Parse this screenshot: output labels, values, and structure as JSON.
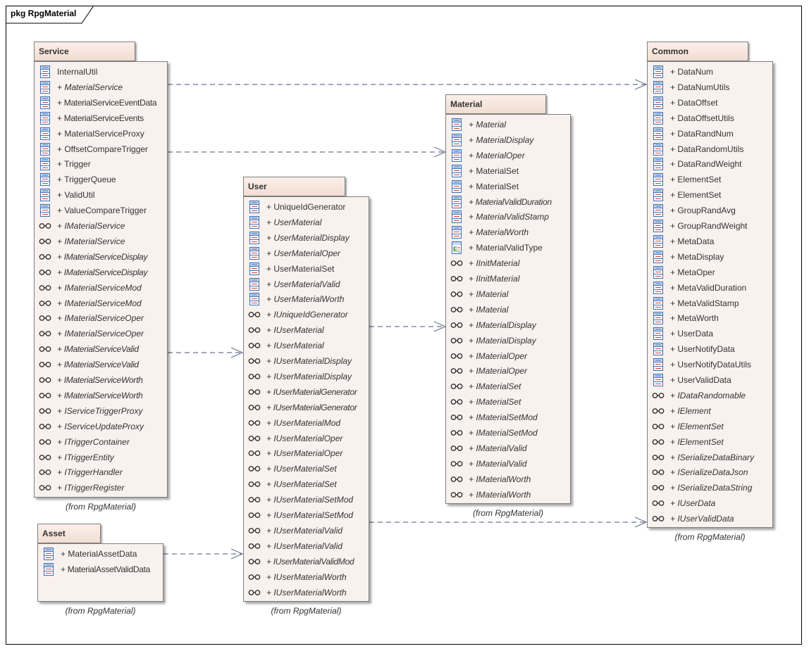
{
  "diagram": {
    "title": "pkg RpgMaterial"
  },
  "packages": [
    {
      "id": "service",
      "name": "Service",
      "from": "(from RpgMaterial)",
      "items": [
        {
          "label": "InternalUtil",
          "kind": "class",
          "italic": false
        },
        {
          "label": "+ MaterialService",
          "kind": "class",
          "italic": true
        },
        {
          "label": "+ MaterialServiceEventData",
          "kind": "class",
          "italic": false
        },
        {
          "label": "+ MaterialServiceEvents",
          "kind": "class",
          "italic": false
        },
        {
          "label": "+ MaterialServiceProxy",
          "kind": "class",
          "italic": false
        },
        {
          "label": "+ OffsetCompareTrigger",
          "kind": "class",
          "italic": false
        },
        {
          "label": "+ Trigger",
          "kind": "class",
          "italic": false
        },
        {
          "label": "+ TriggerQueue",
          "kind": "class",
          "italic": false
        },
        {
          "label": "+ ValidUtil",
          "kind": "class",
          "italic": false
        },
        {
          "label": "+ ValueCompareTrigger",
          "kind": "class",
          "italic": false
        },
        {
          "label": "+ IMaterialService",
          "kind": "interface",
          "italic": true
        },
        {
          "label": "+ IMaterialService",
          "kind": "interface",
          "italic": true
        },
        {
          "label": "+ IMaterialServiceDisplay",
          "kind": "interface",
          "italic": true
        },
        {
          "label": "+ IMaterialServiceDisplay",
          "kind": "interface",
          "italic": true
        },
        {
          "label": "+ IMaterialServiceMod",
          "kind": "interface",
          "italic": true
        },
        {
          "label": "+ IMaterialServiceMod",
          "kind": "interface",
          "italic": true
        },
        {
          "label": "+ IMaterialServiceOper",
          "kind": "interface",
          "italic": true
        },
        {
          "label": "+ IMaterialServiceOper",
          "kind": "interface",
          "italic": true
        },
        {
          "label": "+ IMaterialServiceValid",
          "kind": "interface",
          "italic": true
        },
        {
          "label": "+ IMaterialServiceValid",
          "kind": "interface",
          "italic": true
        },
        {
          "label": "+ IMaterialServiceWorth",
          "kind": "interface",
          "italic": true
        },
        {
          "label": "+ IMaterialServiceWorth",
          "kind": "interface",
          "italic": true
        },
        {
          "label": "+ IServiceTriggerProxy",
          "kind": "interface",
          "italic": true
        },
        {
          "label": "+ IServiceUpdateProxy",
          "kind": "interface",
          "italic": true
        },
        {
          "label": "+ ITriggerContainer",
          "kind": "interface",
          "italic": true
        },
        {
          "label": "+ ITriggerEntity",
          "kind": "interface",
          "italic": true
        },
        {
          "label": "+ ITriggerHandler",
          "kind": "interface",
          "italic": true
        },
        {
          "label": "+ ITriggerRegister",
          "kind": "interface",
          "italic": true
        }
      ]
    },
    {
      "id": "asset",
      "name": "Asset",
      "from": "(from RpgMaterial)",
      "items": [
        {
          "label": "+ MaterialAssetData",
          "kind": "class",
          "italic": false
        },
        {
          "label": "+ MaterialAssetValidData",
          "kind": "class",
          "italic": false
        }
      ]
    },
    {
      "id": "user",
      "name": "User",
      "from": "(from RpgMaterial)",
      "items": [
        {
          "label": "+ UniqueIdGenerator",
          "kind": "class",
          "italic": false
        },
        {
          "label": "+ UserMaterial",
          "kind": "class",
          "italic": true
        },
        {
          "label": "+ UserMaterialDisplay",
          "kind": "class",
          "italic": true
        },
        {
          "label": "+ UserMaterialOper",
          "kind": "class",
          "italic": true
        },
        {
          "label": "+ UserMaterialSet",
          "kind": "class",
          "italic": false
        },
        {
          "label": "+ UserMaterialValid",
          "kind": "class",
          "italic": true
        },
        {
          "label": "+ UserMaterialWorth",
          "kind": "class",
          "italic": true
        },
        {
          "label": "+ IUniqueIdGenerator",
          "kind": "interface",
          "italic": true
        },
        {
          "label": "+ IUserMaterial",
          "kind": "interface",
          "italic": true
        },
        {
          "label": "+ IUserMaterial",
          "kind": "interface",
          "italic": true
        },
        {
          "label": "+ IUserMaterialDisplay",
          "kind": "interface",
          "italic": true
        },
        {
          "label": "+ IUserMaterialDisplay",
          "kind": "interface",
          "italic": true
        },
        {
          "label": "+ IUserMaterialGenerator",
          "kind": "interface",
          "italic": true
        },
        {
          "label": "+ IUserMaterialGenerator",
          "kind": "interface",
          "italic": true
        },
        {
          "label": "+ IUserMaterialMod",
          "kind": "interface",
          "italic": true
        },
        {
          "label": "+ IUserMaterialOper",
          "kind": "interface",
          "italic": true
        },
        {
          "label": "+ IUserMaterialOper",
          "kind": "interface",
          "italic": true
        },
        {
          "label": "+ IUserMaterialSet",
          "kind": "interface",
          "italic": true
        },
        {
          "label": "+ IUserMaterialSet",
          "kind": "interface",
          "italic": true
        },
        {
          "label": "+ IUserMaterialSetMod",
          "kind": "interface",
          "italic": true
        },
        {
          "label": "+ IUserMaterialSetMod",
          "kind": "interface",
          "italic": true
        },
        {
          "label": "+ IUserMaterialValid",
          "kind": "interface",
          "italic": true
        },
        {
          "label": "+ IUserMaterialValid",
          "kind": "interface",
          "italic": true
        },
        {
          "label": "+ IUserMaterialValidMod",
          "kind": "interface",
          "italic": true
        },
        {
          "label": "+ IUserMaterialWorth",
          "kind": "interface",
          "italic": true
        },
        {
          "label": "+ IUserMaterialWorth",
          "kind": "interface",
          "italic": true
        }
      ]
    },
    {
      "id": "material",
      "name": "Material",
      "from": "(from RpgMaterial)",
      "items": [
        {
          "label": "+ Material",
          "kind": "class",
          "italic": true
        },
        {
          "label": "+ MaterialDisplay",
          "kind": "class",
          "italic": true
        },
        {
          "label": "+ MaterialOper",
          "kind": "class",
          "italic": true
        },
        {
          "label": "+ MaterialSet",
          "kind": "class",
          "italic": false
        },
        {
          "label": "+ MaterialSet",
          "kind": "class",
          "italic": false
        },
        {
          "label": "+ MaterialValidDuration",
          "kind": "class",
          "italic": true
        },
        {
          "label": "+ MaterialValidStamp",
          "kind": "class",
          "italic": true
        },
        {
          "label": "+ MaterialWorth",
          "kind": "class",
          "italic": true
        },
        {
          "label": "+ MaterialValidType",
          "kind": "enum",
          "italic": false
        },
        {
          "label": "+ IInitMaterial",
          "kind": "interface",
          "italic": true
        },
        {
          "label": "+ IInitMaterial",
          "kind": "interface",
          "italic": true
        },
        {
          "label": "+ IMaterial",
          "kind": "interface",
          "italic": true
        },
        {
          "label": "+ IMaterial",
          "kind": "interface",
          "italic": true
        },
        {
          "label": "+ IMaterialDisplay",
          "kind": "interface",
          "italic": true
        },
        {
          "label": "+ IMaterialDisplay",
          "kind": "interface",
          "italic": true
        },
        {
          "label": "+ IMaterialOper",
          "kind": "interface",
          "italic": true
        },
        {
          "label": "+ IMaterialOper",
          "kind": "interface",
          "italic": true
        },
        {
          "label": "+ IMaterialSet",
          "kind": "interface",
          "italic": true
        },
        {
          "label": "+ IMaterialSet",
          "kind": "interface",
          "italic": true
        },
        {
          "label": "+ IMaterialSetMod",
          "kind": "interface",
          "italic": true
        },
        {
          "label": "+ IMaterialSetMod",
          "kind": "interface",
          "italic": true
        },
        {
          "label": "+ IMaterialValid",
          "kind": "interface",
          "italic": true
        },
        {
          "label": "+ IMaterialValid",
          "kind": "interface",
          "italic": true
        },
        {
          "label": "+ IMaterialWorth",
          "kind": "interface",
          "italic": true
        },
        {
          "label": "+ IMaterialWorth",
          "kind": "interface",
          "italic": true
        }
      ]
    },
    {
      "id": "common",
      "name": "Common",
      "from": "(from RpgMaterial)",
      "items": [
        {
          "label": "+ DataNum",
          "kind": "class",
          "italic": false
        },
        {
          "label": "+ DataNumUtils",
          "kind": "class",
          "italic": false
        },
        {
          "label": "+ DataOffset",
          "kind": "class",
          "italic": false
        },
        {
          "label": "+ DataOffsetUtils",
          "kind": "class",
          "italic": false
        },
        {
          "label": "+ DataRandNum",
          "kind": "class",
          "italic": false
        },
        {
          "label": "+ DataRandomUtils",
          "kind": "class",
          "italic": false
        },
        {
          "label": "+ DataRandWeight",
          "kind": "class",
          "italic": false
        },
        {
          "label": "+ ElementSet",
          "kind": "class",
          "italic": false
        },
        {
          "label": "+ ElementSet",
          "kind": "class",
          "italic": false
        },
        {
          "label": "+ GroupRandAvg",
          "kind": "class",
          "italic": false
        },
        {
          "label": "+ GroupRandWeight",
          "kind": "class",
          "italic": false
        },
        {
          "label": "+ MetaData",
          "kind": "class",
          "italic": false
        },
        {
          "label": "+ MetaDisplay",
          "kind": "class",
          "italic": false
        },
        {
          "label": "+ MetaOper",
          "kind": "class",
          "italic": false
        },
        {
          "label": "+ MetaValidDuration",
          "kind": "class",
          "italic": false
        },
        {
          "label": "+ MetaValidStamp",
          "kind": "class",
          "italic": false
        },
        {
          "label": "+ MetaWorth",
          "kind": "class",
          "italic": false
        },
        {
          "label": "+ UserData",
          "kind": "class",
          "italic": false
        },
        {
          "label": "+ UserNotifyData",
          "kind": "class",
          "italic": false
        },
        {
          "label": "+ UserNotifyDataUtils",
          "kind": "class",
          "italic": false
        },
        {
          "label": "+ UserValidData",
          "kind": "class",
          "italic": false
        },
        {
          "label": "+ IDataRandomable",
          "kind": "interface",
          "italic": true
        },
        {
          "label": "+ IElement",
          "kind": "interface",
          "italic": true
        },
        {
          "label": "+ IElementSet",
          "kind": "interface",
          "italic": true
        },
        {
          "label": "+ IElementSet",
          "kind": "interface",
          "italic": true
        },
        {
          "label": "+ ISerializeDataBinary",
          "kind": "interface",
          "italic": true
        },
        {
          "label": "+ ISerializeDataJson",
          "kind": "interface",
          "italic": true
        },
        {
          "label": "+ ISerializeDataString",
          "kind": "interface",
          "italic": true
        },
        {
          "label": "+ IUserData",
          "kind": "interface",
          "italic": true
        },
        {
          "label": "+ IUserValidData",
          "kind": "interface",
          "italic": true
        }
      ]
    }
  ],
  "dependencies": [
    {
      "from": "Service",
      "to": "Common"
    },
    {
      "from": "Service",
      "to": "Material"
    },
    {
      "from": "Service",
      "to": "User"
    },
    {
      "from": "User",
      "to": "Material"
    },
    {
      "from": "User",
      "to": "Common"
    },
    {
      "from": "Asset",
      "to": "User"
    }
  ],
  "colors": {
    "package_fill": "#f8f1ee",
    "tab_fill": "#f2ddd2",
    "border": "#7f7f7f",
    "connector": "#6d7590",
    "class_icon": "#3d6fb6",
    "interface_icon": "#333333"
  }
}
